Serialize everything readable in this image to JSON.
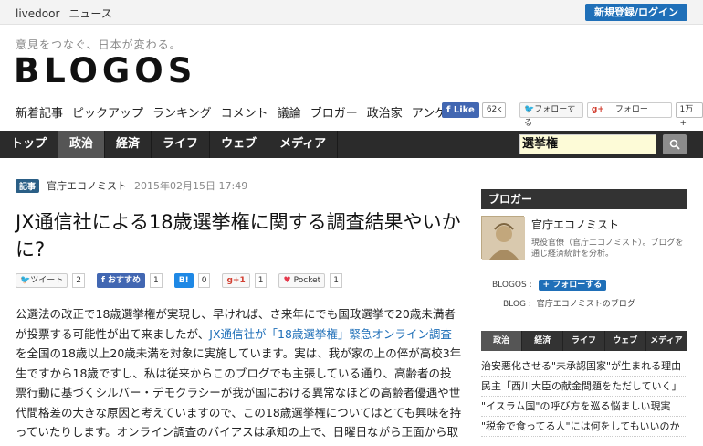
{
  "topbar": {
    "brand": "livedoor",
    "news": "ニュース",
    "login": "新規登録/ログイン"
  },
  "header": {
    "tagline": "意見をつなぐ、日本が変わる。",
    "logo": "BLOGOS"
  },
  "nav_links": [
    "新着記事",
    "ピックアップ",
    "ランキング",
    "コメント",
    "議論",
    "ブロガー",
    "政治家",
    "アンケート"
  ],
  "social": {
    "fb_like": "Like",
    "fb_count": "62k",
    "tw_follow": "フォローする",
    "gp_label": "フォロー",
    "gp_count": "1万+"
  },
  "darknav": {
    "tabs": [
      "トップ",
      "政治",
      "経済",
      "ライフ",
      "ウェブ",
      "メディア"
    ],
    "active": "政治",
    "search_value": "選挙権"
  },
  "article": {
    "category": "記事",
    "author": "官庁エコノミスト",
    "date": "2015年02月15日 17:49",
    "title": "JX通信社による18歳選挙権に関する調査結果やいかに?",
    "share": {
      "tweet": "ツイート",
      "tweet_count": "2",
      "fb": "おすすめ",
      "fb_count": "1",
      "hb": "B!",
      "hb_count": "0",
      "gp": "g+1",
      "gp_count": "1",
      "pocket": "Pocket",
      "pocket_count": "1"
    },
    "body_before_link": "公選法の改正で18歳選挙権が実現し、早ければ、さ来年にでも国政選挙で20歳未満者が投票する可能性が出て来ましたが、",
    "body_link": "JX通信社が「18歳選挙権」緊急オンライン調査",
    "body_after_link": "を全国の18歳以上20歳未満を対象に実施しています。実は、我が家の上の倅が高校3年生ですから18歳ですし、私は従来からこのブログでも主張している通り、高齢者の投票行動に基づくシルバー・デモクラシーが我が国における異常なほどの高齢者優遇や世代間格差の大きな原因と考えていますので、この18歳選挙権についてはとても興味を持っていたりします。オンライン調査のバイアスは承知の上で、日曜日ながら正面から取り上げて、図表を引用しつつ簡単に紹介します。"
  },
  "sidebar": {
    "head": "ブロガー",
    "name": "官庁エコノミスト",
    "desc": "現役官僚（官庁エコノミスト）。ブログを通じ経済統計を分析。",
    "blogos_label": "BLOGOS :",
    "follow": "フォローする",
    "blog_label": "BLOG :",
    "blog_name": "官庁エコノミストのブログ",
    "tabs": [
      "政治",
      "経済",
      "ライフ",
      "ウェブ",
      "メディア"
    ],
    "active_tab": "政治",
    "items": [
      "治安悪化させる\"未承認国家\"が生まれる理由",
      "民主「西川大臣の献金問題をただしていく」",
      "\"イスラム国\"の呼び方を巡る悩ましい現実",
      "\"税金で食ってる人\"には何をしてもいいのか"
    ]
  }
}
